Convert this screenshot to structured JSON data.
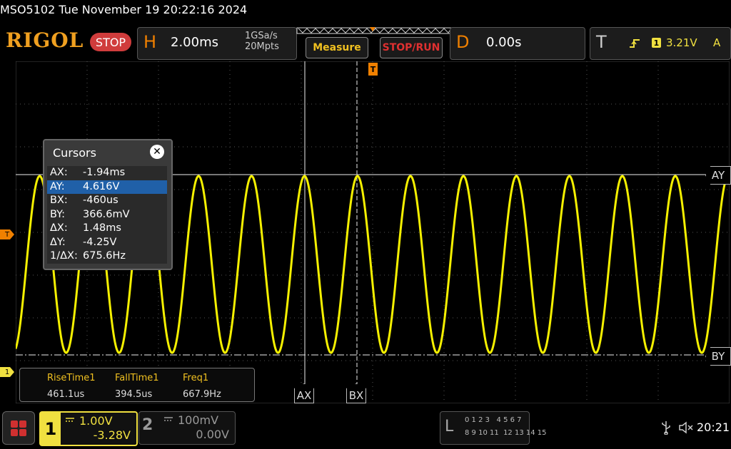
{
  "header": {
    "model_datetime": "MSO5102  Tue November 19 20:22:16 2024",
    "logo": "RIGOL",
    "run_state": "STOP"
  },
  "horizontal": {
    "letter": "H",
    "timebase": "2.00ms",
    "sample_rate": "1GSa/s",
    "memory_depth": "20Mpts"
  },
  "buttons": {
    "measure": "Measure",
    "stop_run": "STOP/RUN"
  },
  "delay": {
    "letter": "D",
    "value": "0.00s"
  },
  "trigger": {
    "letter": "T",
    "channel": "1",
    "level": "3.21V",
    "mode": "A",
    "marker_left": "T",
    "ch1_ground_marker": "1"
  },
  "cursors": {
    "title": "Cursors",
    "close": "✕",
    "rows": [
      {
        "key": "AX:",
        "value": "-1.94ms"
      },
      {
        "key": "AY:",
        "value": "4.616V"
      },
      {
        "key": "BX:",
        "value": "-460us"
      },
      {
        "key": "BY:",
        "value": "366.6mV"
      },
      {
        "key": "ΔX:",
        "value": "1.48ms"
      },
      {
        "key": "ΔY:",
        "value": "-4.25V"
      },
      {
        "key": "1/ΔX:",
        "value": "675.6Hz"
      }
    ],
    "selected_index": 1,
    "tags": {
      "ay": "AY",
      "by": "BY",
      "ax": "AX",
      "bx": "BX"
    }
  },
  "measurements": [
    {
      "label": "RiseTime1",
      "value": "461.1us"
    },
    {
      "label": "FallTime1",
      "value": "394.5us"
    },
    {
      "label": "Freq1",
      "value": "667.9Hz"
    }
  ],
  "channel1": {
    "number": "1",
    "scale": "1.00V",
    "offset": "-3.28V"
  },
  "channel2": {
    "number": "2",
    "scale": "100mV",
    "offset": "0.00V"
  },
  "logic": {
    "letter": "L",
    "row1": "0 1 2 3   4 5 6 7",
    "row2": "8 9 10 11  12 13 14 15"
  },
  "status": {
    "time": "20:21",
    "usb_icon": "usb-icon",
    "mute_icon": "speaker-muted-icon"
  },
  "colors": {
    "trace": "#f5f000",
    "accent_orange": "#f08000",
    "selected_row": "#2060a8",
    "stop_red": "#d03c3c"
  }
}
